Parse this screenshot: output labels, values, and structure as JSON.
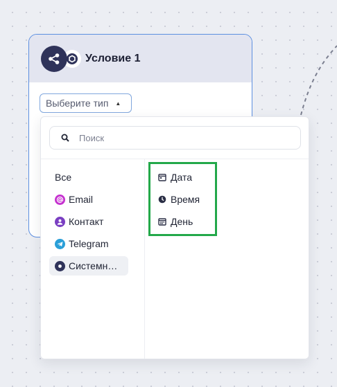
{
  "node": {
    "title": "Условие 1",
    "icon": "share-nodes-icon",
    "badge_icon": "hexagon-icon",
    "border_color": "#5b8ee0"
  },
  "type_select": {
    "label": "Выберите тип",
    "expanded": true
  },
  "search": {
    "placeholder": "Поиск",
    "value": ""
  },
  "categories": [
    {
      "label": "Все",
      "icon": null
    },
    {
      "label": "Email",
      "icon": "at-sign-icon",
      "color": "#c531cf"
    },
    {
      "label": "Контакт",
      "icon": "user-icon",
      "color": "#7a3fc2"
    },
    {
      "label": "Telegram",
      "icon": "telegram-icon",
      "color": "#2a9fd8"
    },
    {
      "label": "Системн…",
      "icon": "system-icon",
      "color": "#2f335a",
      "selected": true
    }
  ],
  "options": [
    {
      "label": "Дата",
      "icon": "calendar-icon"
    },
    {
      "label": "Время",
      "icon": "clock-icon"
    },
    {
      "label": "День",
      "icon": "calendar-grid-icon"
    }
  ],
  "colors": {
    "accent": "#5b8ee0",
    "highlight": "#23a84a",
    "dark": "#2f335a"
  }
}
